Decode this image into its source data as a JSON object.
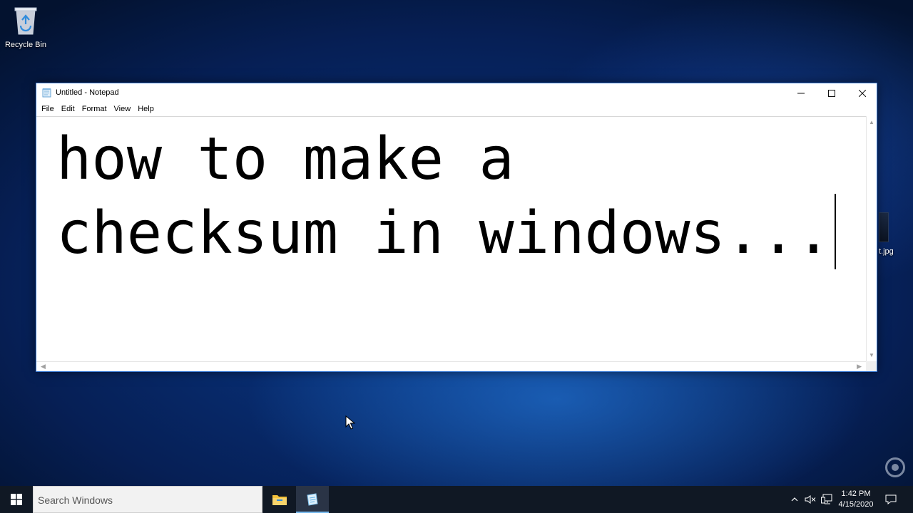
{
  "desktop": {
    "recycle_bin_label": "Recycle Bin",
    "partial_file_label": "t.jpg"
  },
  "notepad": {
    "title": "Untitled - Notepad",
    "menu": [
      "File",
      "Edit",
      "Format",
      "View",
      "Help"
    ],
    "content_line1": "how to make a",
    "content_line2": "checksum in windows..."
  },
  "taskbar": {
    "search_placeholder": "Search Windows",
    "clock_time": "1:42 PM",
    "clock_date": "4/15/2020"
  },
  "colors": {
    "taskbar_bg": "#101824",
    "window_border": "#3a7bd5",
    "taskbar_active_underline": "#76b9ed"
  },
  "icons": {
    "start": "windows-start-icon",
    "explorer": "file-explorer-icon",
    "notepad": "notepad-icon",
    "recycle": "recycle-bin-icon"
  }
}
